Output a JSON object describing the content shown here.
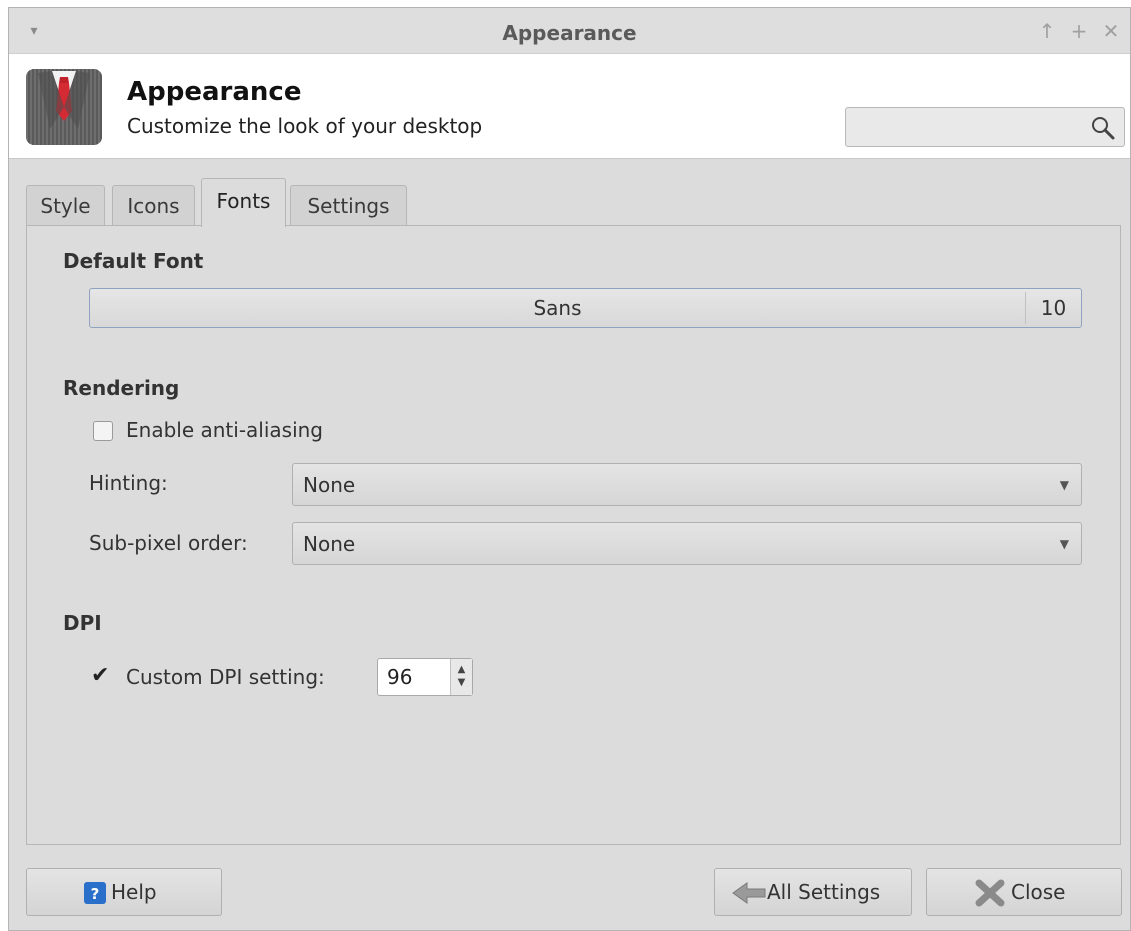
{
  "window": {
    "title": "Appearance",
    "menu_glyph": "▾",
    "buttons": {
      "up": "↑",
      "maximize": "+",
      "close": "✕"
    }
  },
  "header": {
    "title": "Appearance",
    "subtitle": "Customize the look of your desktop",
    "search_value": ""
  },
  "tabs": [
    {
      "label": "Style",
      "active": false
    },
    {
      "label": "Icons",
      "active": false
    },
    {
      "label": "Fonts",
      "active": true
    },
    {
      "label": "Settings",
      "active": false
    }
  ],
  "default_font": {
    "heading": "Default Font",
    "font_name": "Sans",
    "font_size": "10"
  },
  "rendering": {
    "heading": "Rendering",
    "antialias_label": "Enable anti-aliasing",
    "antialias_checked": false,
    "hinting_label": "Hinting:",
    "hinting_value": "None",
    "subpixel_label": "Sub-pixel order:",
    "subpixel_value": "None"
  },
  "dpi": {
    "heading": "DPI",
    "custom_label": "Custom DPI setting:",
    "custom_checked": true,
    "value": "96"
  },
  "footer": {
    "help_label": "Help",
    "all_settings_label": "All Settings",
    "close_label": "Close"
  },
  "icons": {
    "app": "suit-icon",
    "search": "magnifier-icon",
    "help": "help-icon",
    "all_settings": "back-arrow-icon",
    "close": "close-x-icon"
  },
  "colors": {
    "window_bg": "#dcdcdc",
    "header_bg": "#ffffff",
    "help_blue": "#2a6fc9"
  }
}
